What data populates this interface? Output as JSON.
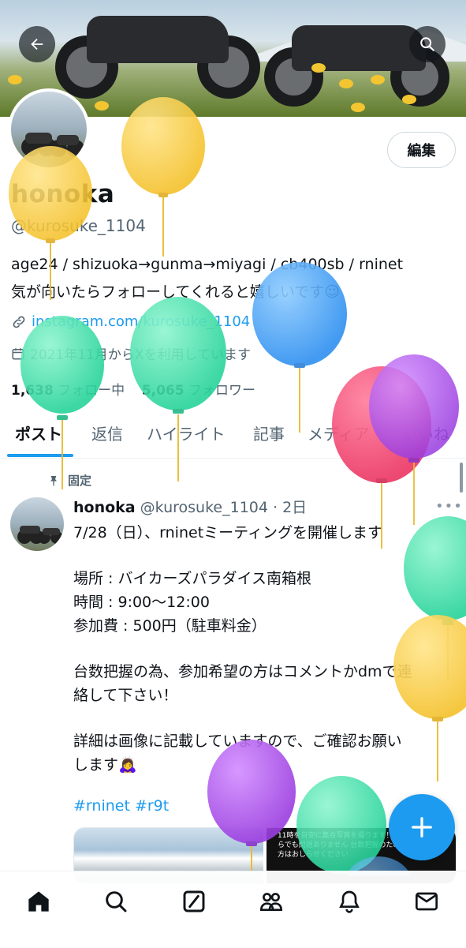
{
  "colors": {
    "accent": "#1d9bf0",
    "text_primary": "#0f1419",
    "text_secondary": "#536471"
  },
  "header": {
    "back_icon": "arrow-left-icon",
    "search_icon": "search-icon"
  },
  "profile": {
    "edit_label": "編集",
    "display_name": "honoka",
    "handle": "@kurosuke_1104",
    "bio_line1": "age24 / shizuoka→gunma→miyagi / cb400sb / rninet",
    "bio_line2": "気が向いたらフォローしてくれると嬉しいです☺",
    "link": "instagram.com/kurosuke_1104",
    "joined": "2021年11月からXを利用しています",
    "following_count": "1,638",
    "following_label": "フォロー中",
    "followers_count": "5,065",
    "followers_label": "フォロワー"
  },
  "tabs": [
    {
      "label": "ポスト",
      "active": true
    },
    {
      "label": "返信"
    },
    {
      "label": "ハイライト"
    },
    {
      "label": "記事"
    },
    {
      "label": "メディア"
    },
    {
      "label": "いいね"
    }
  ],
  "tweet": {
    "pinned_label": "固定",
    "author": "honoka",
    "meta": "@kurosuke_1104 · 2日",
    "lines": [
      "7/28（日）、rninetミーティングを開催します",
      "",
      "場所 : バイカーズパラダイス南箱根",
      "時間 : 9:00〜12:00",
      "参加費 : 500円（駐車料金）",
      "",
      "台数把握の為、参加希望の方はコメントかdmで連",
      "絡して下さい！",
      "",
      "詳細は画像に記載していますので、ご確認お願い",
      "します🙇‍♀️"
    ],
    "hashtags": "#rninet #r9t",
    "image_right_text": "11時を目安に集合写真を撮ります！ 参加は何時からでも問題ありません 台数把握のため、参加予定の方はおしらせください"
  },
  "fab_icon": "plus-icon",
  "bottom_nav": [
    "home-icon",
    "search-icon",
    "grok-icon",
    "communities-icon",
    "notifications-icon",
    "messages-icon"
  ]
}
